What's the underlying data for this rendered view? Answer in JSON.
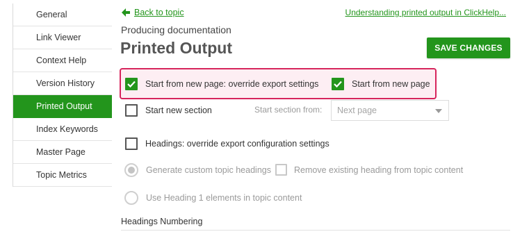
{
  "sidebar": {
    "items": [
      {
        "label": "General"
      },
      {
        "label": "Link Viewer"
      },
      {
        "label": "Context Help"
      },
      {
        "label": "Version History"
      },
      {
        "label": "Printed Output",
        "active": true
      },
      {
        "label": "Index Keywords"
      },
      {
        "label": "Master Page"
      },
      {
        "label": "Topic Metrics"
      }
    ]
  },
  "header": {
    "back_link": "Back to topic",
    "help_link": "Understanding printed output in ClickHelp...",
    "subtitle": "Producing documentation",
    "title": "Printed Output",
    "save_label": "SAVE CHANGES"
  },
  "options": {
    "override_page": {
      "label": "Start from new page: override export settings",
      "checked": true
    },
    "start_new_page": {
      "label": "Start from new page",
      "checked": true
    },
    "start_new_section": {
      "label": "Start new section",
      "checked": false
    },
    "section_from_label": "Start section from:",
    "section_from_value": "Next page",
    "headings_override": {
      "label": "Headings: override export configuration settings",
      "checked": false
    },
    "generate_headings": {
      "label": "Generate custom topic headings",
      "selected": true,
      "disabled": true
    },
    "remove_heading": {
      "label": "Remove existing heading from topic content",
      "checked": false,
      "disabled": true
    },
    "use_heading1": {
      "label": "Use Heading 1 elements in topic content",
      "selected": false,
      "disabled": true
    },
    "headings_numbering": "Headings Numbering"
  },
  "colors": {
    "accent": "#23951c",
    "highlight_border": "#d6245c",
    "highlight_bg": "#fdeef3"
  }
}
